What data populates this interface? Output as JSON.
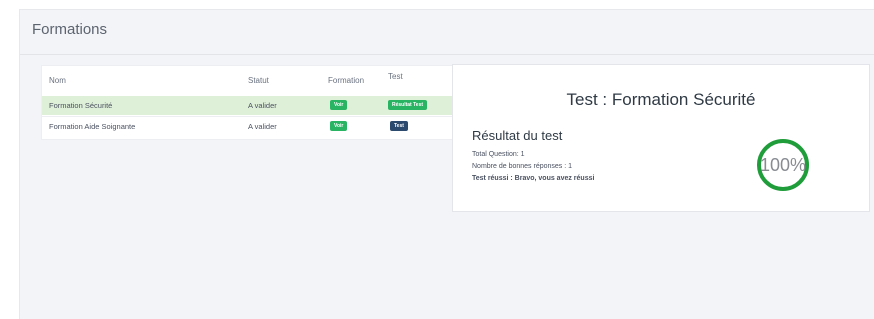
{
  "header": {
    "title": "Formations"
  },
  "table": {
    "columns": [
      "Nom",
      "Statut",
      "Formation",
      "Test"
    ],
    "rows": [
      {
        "nom": "Formation Sécurité",
        "statut": "A valider",
        "formation_btn": "Voir",
        "test_btn": "Résultat Test",
        "highlighted": true
      },
      {
        "nom": "Formation Aide Soignante",
        "statut": "A valider",
        "formation_btn": "Voir",
        "test_btn": "Test",
        "highlighted": false
      }
    ]
  },
  "result": {
    "title": "Test : Formation Sécurité",
    "subtitle": "Résultat du test",
    "total_questions": "Total Question: 1",
    "good_answers": "Nombre de bonnes réponses : 1",
    "passed": "Test réussi : Bravo, vous avez réussi",
    "score_label": "100%",
    "score_fraction": 1.0
  },
  "colors": {
    "success": "#28b463",
    "navy": "#2c4a6e",
    "row_highlight": "#dff0d8",
    "ring": "#1f9d3a"
  }
}
